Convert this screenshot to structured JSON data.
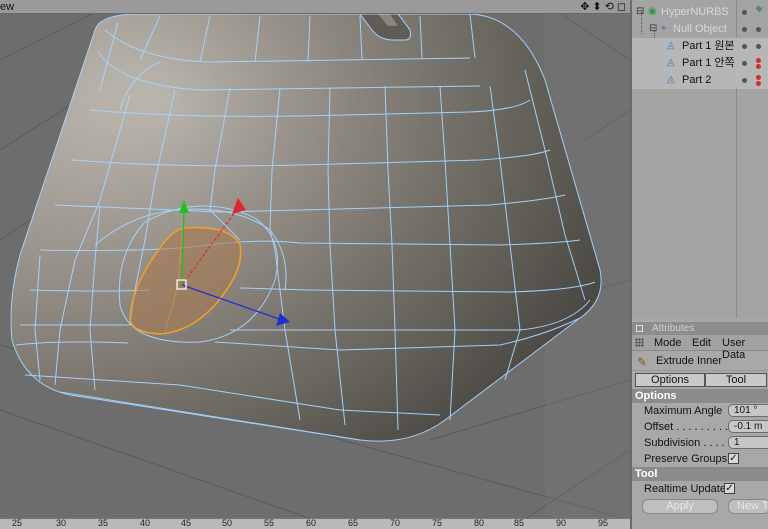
{
  "viewport": {
    "title": "ew",
    "nav_icons": [
      "✥",
      "⬍",
      "⟲",
      "◻"
    ],
    "ruler_labels": [
      "25",
      "30",
      "35",
      "40",
      "45",
      "50",
      "55",
      "60",
      "65",
      "70",
      "75",
      "80",
      "85",
      "90",
      "95"
    ]
  },
  "object_manager": {
    "objects": [
      {
        "name": "HyperNURBS",
        "icon": "hypernurbs-icon",
        "check": "✓"
      },
      {
        "name": "Null Object",
        "icon": "null-object-icon",
        "check": ""
      },
      {
        "name": "Part 1 원본",
        "icon": "polygon-object-icon",
        "check": ""
      },
      {
        "name": "Part 1 안쪽",
        "icon": "polygon-object-icon",
        "check": ""
      },
      {
        "name": "Part 2",
        "icon": "polygon-object-icon",
        "check": ""
      }
    ]
  },
  "attributes": {
    "header": "Attributes",
    "menu": [
      "Mode",
      "Edit",
      "User Data"
    ],
    "tool_name": "Extrude Inner",
    "tabs": [
      "Options",
      "Tool"
    ],
    "options_section": "Options",
    "properties": [
      {
        "label": "Maximum Angle",
        "value": "101 °"
      },
      {
        "label": "Offset . . . . . . . . . .",
        "value": "-0.1 m"
      },
      {
        "label": "Subdivision . . . .",
        "value": "1"
      }
    ],
    "preserve_groups_label": "Preserve Groups",
    "preserve_groups_checked": "✓",
    "tool_section": "Tool",
    "realtime_update_label": "Realtime Update",
    "realtime_update_checked": "✓",
    "apply_label": "Apply",
    "new_label": "New T"
  },
  "colors": {
    "selection": "#f0a02a",
    "wireframe": "#a8d4ff",
    "axis_x": "#e0282c",
    "axis_y": "#20c020",
    "axis_z": "#2030d0"
  }
}
